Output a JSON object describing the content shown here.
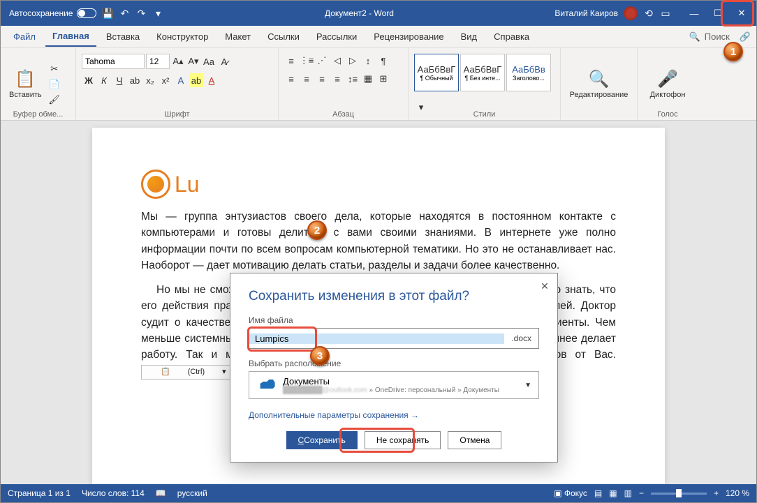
{
  "titlebar": {
    "autosave": "Автосохранение",
    "doc_title": "Документ2 - Word",
    "user": "Виталий Каиров"
  },
  "tabs": {
    "file": "Файл",
    "home": "Главная",
    "insert": "Вставка",
    "design": "Конструктор",
    "layout": "Макет",
    "references": "Ссылки",
    "mailings": "Рассылки",
    "review": "Рецензирование",
    "view": "Вид",
    "help": "Справка",
    "search": "Поиск"
  },
  "ribbon": {
    "paste": "Вставить",
    "clipboard": "Буфер обме...",
    "font_name": "Tahoma",
    "font_size": "12",
    "font_group": "Шрифт",
    "para_group": "Абзац",
    "styles_group": "Стили",
    "editing": "Редактирование",
    "voice": "Диктофон",
    "voice_group": "Голос",
    "style1_prev": "АаБбВвГ",
    "style1_name": "¶ Обычный",
    "style2_prev": "АаБбВвГ",
    "style2_name": "¶ Без инте...",
    "style3_prev": "АаБбВв",
    "style3_name": "Заголово..."
  },
  "document": {
    "logo": "Lu",
    "p1": "Мы — группа энтузиастов своего дела, которые находятся в постоянном контакте с компьютерами и готовы делиться с вами своими знаниями. В интернете уже полно информации почти по всем вопросам компьютерной тематики. Но это не останавливает нас. Наоборот — дает мотивацию делать статьи, разделы и задачи более качественно.",
    "p2": "Но мы не сможем улучшаться без вашей поддержки. Любому человеку важно знать, что его действия правильные. Писатель судит о своей работе по отзывам читателей. Доктор судит о качестве своей работы по тому, как быстро выздоравливают его пациенты. Чем меньше системный администратор бегает и что-то настраивает, тем он качественнее делает работу. Так и мы не можем улучшаться, если не будем получать ответов от Вас.",
    "paste_hint": "(Ctrl)"
  },
  "dialog": {
    "title": "Сохранить изменения в этот файл?",
    "filename_label": "Имя файла",
    "filename": "Lumpics",
    "ext": ".docx",
    "location_label": "Выбрать расположение",
    "location_name": "Документы",
    "location_path": " » OneDrive: персональный » Документы",
    "more": "Дополнительные параметры сохранения →",
    "save": "Сохранить",
    "dont_save": "Не сохранять",
    "cancel": "Отмена"
  },
  "statusbar": {
    "page": "Страница 1 из 1",
    "words": "Число слов: 114",
    "lang": "русский",
    "focus": "Фокус",
    "zoom": "120 %"
  },
  "callouts": {
    "n1": "1",
    "n2": "2",
    "n3": "3"
  }
}
